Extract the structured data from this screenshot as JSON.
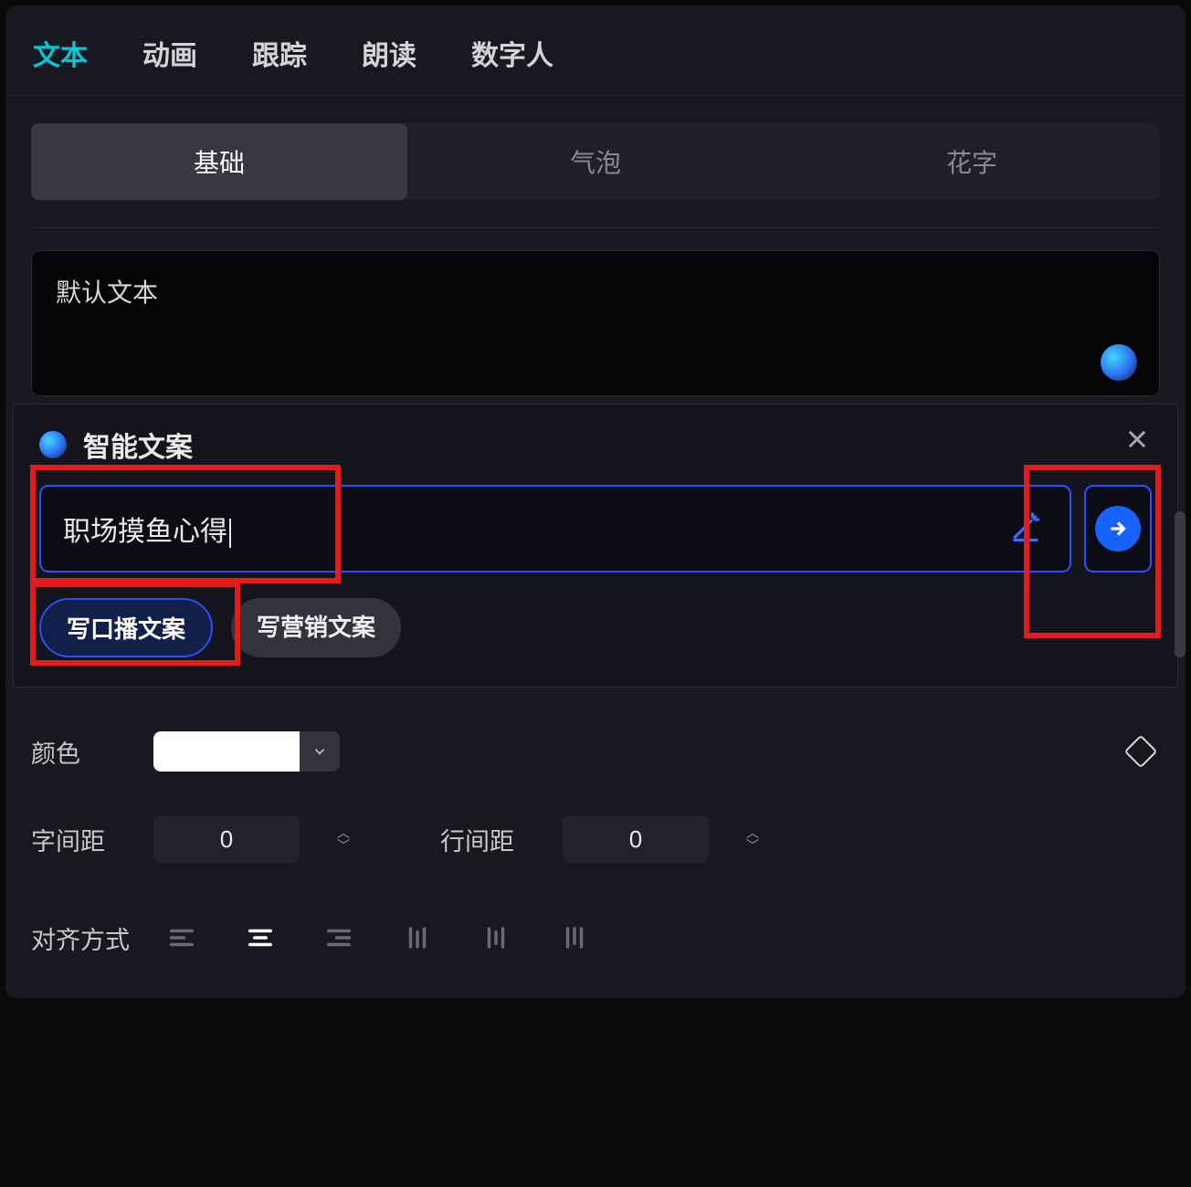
{
  "topTabs": {
    "text": "文本",
    "animation": "动画",
    "tracking": "跟踪",
    "narration": "朗读",
    "digitalHuman": "数字人"
  },
  "subTabs": {
    "basic": "基础",
    "bubble": "气泡",
    "fancy": "花字"
  },
  "defaultText": "默认文本",
  "smartCopy": {
    "title": "智能文案",
    "inputValue": "职场摸鱼心得",
    "chipBroadcast": "写口播文案",
    "chipMarketing": "写营销文案"
  },
  "props": {
    "colorLabel": "颜色",
    "colorValue": "#ffffff",
    "letterSpacingLabel": "字间距",
    "letterSpacingValue": "0",
    "lineSpacingLabel": "行间距",
    "lineSpacingValue": "0",
    "alignLabel": "对齐方式"
  }
}
